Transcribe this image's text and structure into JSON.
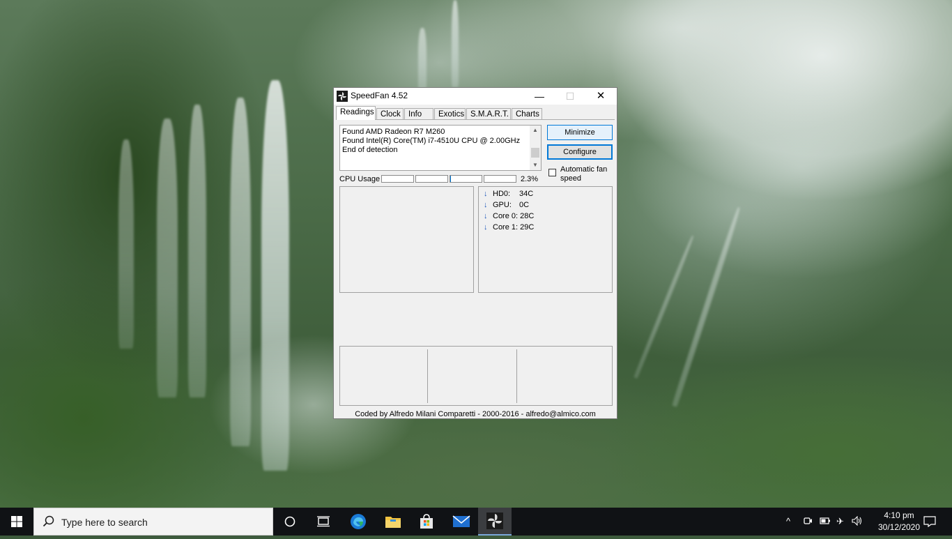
{
  "window": {
    "title": "SpeedFan 4.52",
    "caption_buttons": {
      "minimize": "—",
      "maximize": "☐",
      "close": "✕"
    },
    "tabs": [
      {
        "label": "Readings",
        "active": true
      },
      {
        "label": "Clock",
        "active": false
      },
      {
        "label": "Info",
        "active": false
      },
      {
        "label": "Exotics",
        "active": false
      },
      {
        "label": "S.M.A.R.T.",
        "active": false
      },
      {
        "label": "Charts",
        "active": false
      }
    ],
    "log_lines": [
      "Found AMD Radeon R7 M260",
      "Found Intel(R) Core(TM) i7-4510U CPU @ 2.00GHz",
      "End of detection"
    ],
    "buttons": {
      "minimize": "Minimize",
      "configure": "Configure"
    },
    "automatic_fan_speed": {
      "label": "Automatic fan speed",
      "checked": false
    },
    "cpu_usage": {
      "label": "CPU Usage",
      "value": "2.3%",
      "bars": [
        0,
        0,
        0.02,
        0
      ]
    },
    "readings": [
      {
        "label": "HD0:",
        "value": "34C",
        "trend": "down"
      },
      {
        "label": "GPU:",
        "value": "0C",
        "trend": "down"
      },
      {
        "label": "Core 0:",
        "value": "28C",
        "trend": "down"
      },
      {
        "label": "Core 1:",
        "value": "29C",
        "trend": "down"
      }
    ],
    "footer": "Coded by Alfredo Milani Comparetti - 2000-2016 - alfredo@almico.com"
  },
  "taskbar": {
    "search_placeholder": "Type here to search",
    "pinned": [
      "cortana-icon",
      "task-view-icon",
      "edge-icon",
      "file-explorer-icon",
      "store-icon",
      "mail-icon",
      "speedfan-icon"
    ],
    "clock": {
      "time": "4:10 pm",
      "date": "30/12/2020"
    }
  },
  "colors": {
    "accent": "#0078d7",
    "taskbar": "#101215",
    "window_bg": "#f0f0f0"
  }
}
